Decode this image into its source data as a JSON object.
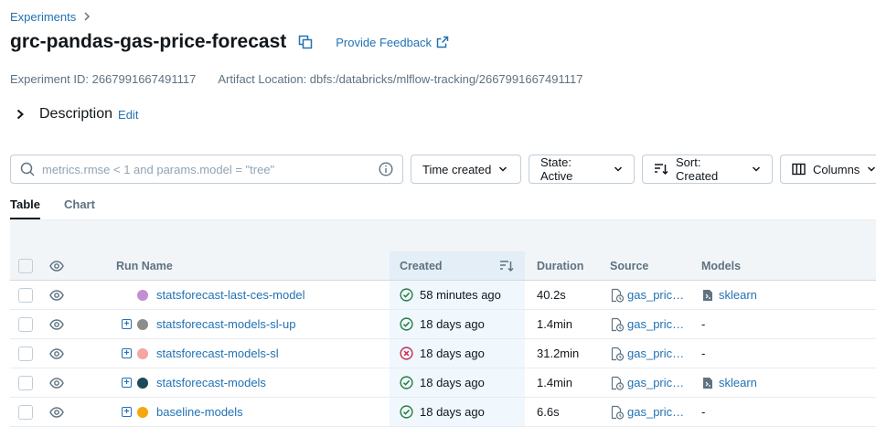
{
  "breadcrumb": {
    "experiments": "Experiments"
  },
  "experiment": {
    "title": "grc-pandas-gas-price-forecast",
    "feedback": "Provide Feedback",
    "id_text": "Experiment ID: 2667991667491117",
    "artifact_text": "Artifact Location: dbfs:/databricks/mlflow-tracking/2667991667491117"
  },
  "description": {
    "label": "Description",
    "edit": "Edit"
  },
  "search": {
    "placeholder": "metrics.rmse < 1 and params.model = \"tree\""
  },
  "filters": {
    "time": "Time created",
    "state": "State: Active",
    "sort": "Sort: Created",
    "columns": "Columns"
  },
  "tabs": {
    "table": "Table",
    "chart": "Chart"
  },
  "table": {
    "headers": {
      "run_name": "Run Name",
      "created": "Created",
      "duration": "Duration",
      "source": "Source",
      "models": "Models"
    },
    "rows": [
      {
        "name": "statsforecast-last-ces-model",
        "color": "#c38fd0",
        "expandable": false,
        "status": "success",
        "created": "58 minutes ago",
        "duration": "40.2s",
        "source": "gas_pric…",
        "model": "sklearn"
      },
      {
        "name": "statsforecast-models-sl-up",
        "color": "#8c8c8c",
        "expandable": true,
        "status": "success",
        "created": "18 days ago",
        "duration": "1.4min",
        "source": "gas_pric…",
        "model": "-"
      },
      {
        "name": "statsforecast-models-sl",
        "color": "#f4a6a1",
        "expandable": true,
        "status": "failed",
        "created": "18 days ago",
        "duration": "31.2min",
        "source": "gas_pric…",
        "model": "-"
      },
      {
        "name": "statsforecast-models",
        "color": "#1b4b5a",
        "expandable": true,
        "status": "success",
        "created": "18 days ago",
        "duration": "1.4min",
        "source": "gas_pric…",
        "model": "sklearn"
      },
      {
        "name": "baseline-models",
        "color": "#f7a70b",
        "expandable": true,
        "status": "success",
        "created": "18 days ago",
        "duration": "6.6s",
        "source": "gas_pric…",
        "model": "-"
      }
    ]
  },
  "colors": {
    "link": "#2272b4",
    "success": "#277c43",
    "error": "#c82d4c"
  }
}
